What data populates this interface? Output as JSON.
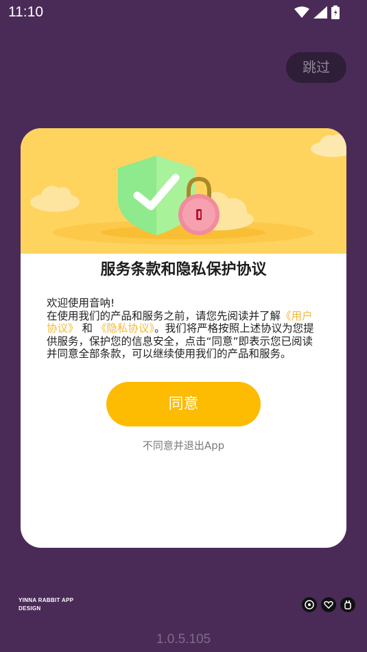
{
  "status_bar": {
    "time": "11:10",
    "icons": [
      "wifi-icon",
      "cellular-signal-icon",
      "battery-icon"
    ]
  },
  "skip_button": {
    "label": "跳过"
  },
  "dialog": {
    "banner_icons": [
      "shield-check-icon",
      "padlock-icon",
      "cloud-icon"
    ],
    "title": "服务条款和隐私保护协议",
    "body": {
      "greeting": "欢迎使用音呐!",
      "text_before_links": "在使用我们的产品和服务之前，请您先阅读并了解",
      "user_agreement_link": "《用户协议》",
      "and_text": "和",
      "privacy_link": "《隐私协议》",
      "text_after_links": "。我们将严格按照上述协议为您提供服务，保护您的信息安全，点击“同意”即表示您已阅读并同意全部条款，可以继续使用我们的产品和服务。"
    },
    "agree_button": "同意",
    "decline_link": "不同意并退出App"
  },
  "footer": {
    "brand_line1": "YINNA RABBIT APP",
    "brand_line2": "DESIGN",
    "social_icons": [
      "music-icon",
      "heart-icon",
      "rabbit-icon"
    ],
    "version": "1.0.5.105"
  },
  "colors": {
    "background": "#4a2b58",
    "banner": "#fed45f",
    "accent": "#fdbb02",
    "link": "#f5b935"
  }
}
